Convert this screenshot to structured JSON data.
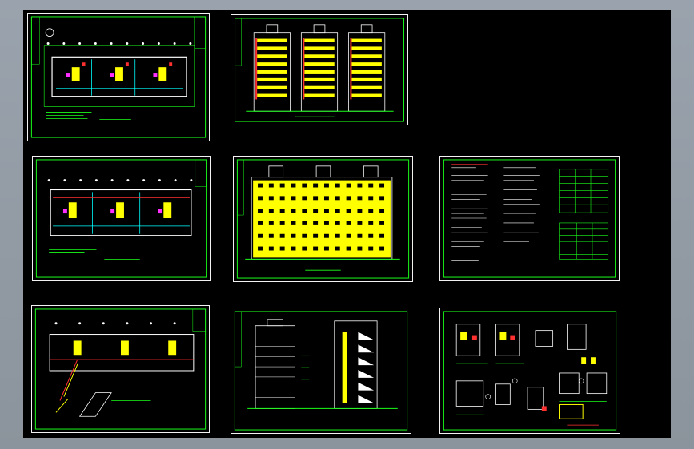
{
  "app": {
    "canvas_background": "#000000",
    "viewport_background": "#9aa3ad"
  },
  "sheets": [
    {
      "id": "plan-1",
      "kind": "floor-plan"
    },
    {
      "id": "elevation-front",
      "kind": "elevation"
    },
    {
      "id": "plan-2",
      "kind": "floor-plan"
    },
    {
      "id": "elevation-rear",
      "kind": "elevation"
    },
    {
      "id": "design-notes",
      "kind": "notes"
    },
    {
      "id": "plan-roof",
      "kind": "floor-plan"
    },
    {
      "id": "elevation-side",
      "kind": "side-elevation"
    },
    {
      "id": "details",
      "kind": "details"
    }
  ],
  "colors": {
    "frame": "#f2f2f2",
    "green": "#1aff1a",
    "yellow": "#ffff00",
    "cyan": "#00ffff",
    "red": "#ff3030",
    "magenta": "#ff30ff",
    "white": "#ffffff"
  }
}
